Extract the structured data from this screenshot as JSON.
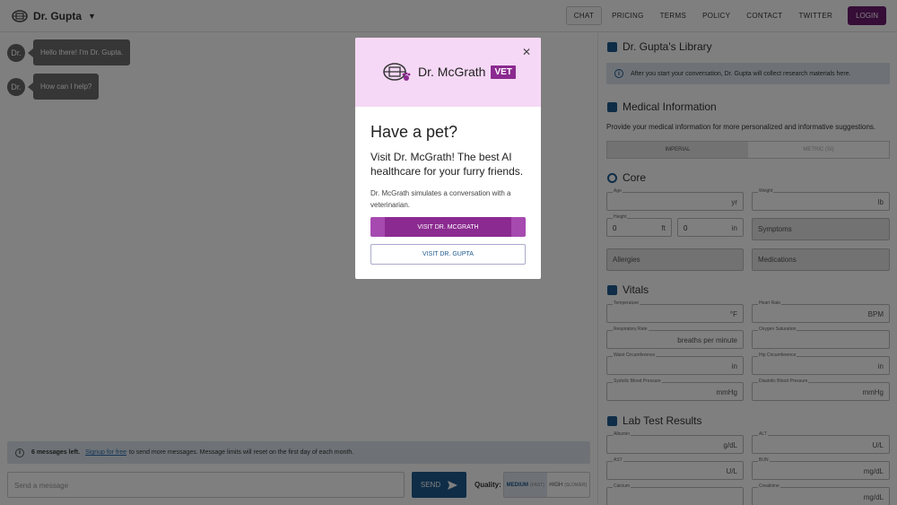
{
  "header": {
    "brand": "Dr. Gupta",
    "nav": [
      "CHAT",
      "PRICING",
      "TERMS",
      "POLICY",
      "CONTACT",
      "TWITTER"
    ],
    "login": "LOGIN"
  },
  "chat": {
    "messages": [
      {
        "avatar": "Dr.",
        "text": "Hello there! I'm Dr. Gupta."
      },
      {
        "avatar": "Dr.",
        "text": "How can I help?"
      }
    ],
    "limit": {
      "count": "6 messages left.",
      "link": "Signup for free",
      "rest": "to send more messages. Message limits will reset on the first day of each month."
    },
    "input_placeholder": "Send a message",
    "send": "SEND",
    "quality_label": "Quality:",
    "quality_options": [
      {
        "label": "MEDIUM",
        "note": "(FAST)"
      },
      {
        "label": "HIGH",
        "note": "(SLOWER)"
      }
    ]
  },
  "panel": {
    "library_title": "Dr. Gupta's Library",
    "library_note": "After you start your conversation, Dr. Gupta will collect research materials here.",
    "medical_title": "Medical Information",
    "medical_sub": "Provide your medical information for more personalized and informative suggestions.",
    "units": [
      "IMPERIAL",
      "METRIC (SI)"
    ],
    "core_title": "Core",
    "age_label": "Age",
    "age_unit": "yr",
    "weight_label": "Weight",
    "weight_unit": "lb",
    "height_label": "Height",
    "height_ft": "0",
    "height_ft_unit": "ft",
    "height_in": "0",
    "height_in_unit": "in",
    "symptoms": "Symptoms",
    "allergies": "Allergies",
    "medications": "Medications",
    "vitals_title": "Vitals",
    "temp_label": "Temperature",
    "temp_unit": "°F",
    "hr_label": "Heart Rate",
    "hr_unit": "BPM",
    "rr_label": "Respiratory Rate",
    "rr_unit": "breaths per minute",
    "o2_label": "Oxygen Saturation",
    "waist_label": "Waist Circumference",
    "waist_unit": "in",
    "hip_label": "Hip Circumference",
    "hip_unit": "in",
    "sys_label": "Systolic Blood Pressure",
    "sys_unit": "mmHg",
    "dia_label": "Diastolic Blood Pressure",
    "dia_unit": "mmHg",
    "lab_title": "Lab Test Results",
    "alb_label": "Albumin",
    "alb_unit": "g/dL",
    "alt_label": "ALT",
    "alt_unit": "U/L",
    "ast_label": "AST",
    "ast_unit": "U/L",
    "bun_label": "BUN",
    "bun_unit": "mg/dL",
    "ca_label": "Calcium",
    "cr_label": "Creatinine",
    "cr_unit": "mg/dL"
  },
  "modal": {
    "logo_name": "Dr. McGrath",
    "logo_badge": "VET",
    "heading": "Have a pet?",
    "lead": "Visit Dr. McGrath! The best AI healthcare for your furry friends.",
    "body": "Dr. McGrath simulates a conversation with a veterinarian.",
    "primary": "VISIT DR. MCGRATH",
    "secondary": "VISIT DR. GUPTA"
  },
  "colors": {
    "accent": "#1f5a8e",
    "vet": "#8b2a90",
    "login": "#6b1a6e"
  }
}
